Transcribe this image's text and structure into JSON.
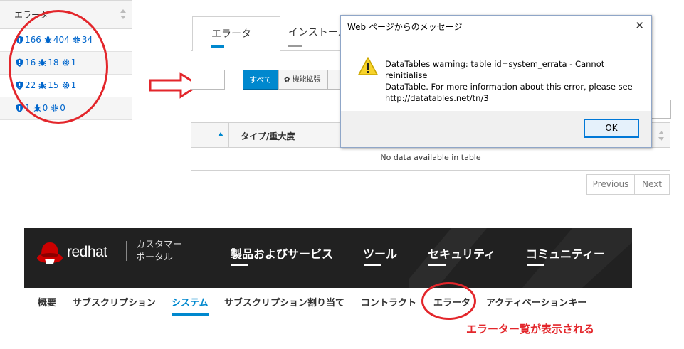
{
  "errata_table": {
    "header": "エラータ",
    "rows": [
      {
        "security": "166",
        "bugfix": "404",
        "enhancement": "34"
      },
      {
        "security": "16",
        "bugfix": "18",
        "enhancement": "1"
      },
      {
        "security": "22",
        "bugfix": "15",
        "enhancement": "1"
      },
      {
        "security": "1",
        "bugfix": "0",
        "enhancement": "0"
      }
    ]
  },
  "tabs": {
    "errata": "エラータ",
    "install": "インストール"
  },
  "filters": {
    "all": "すべて",
    "enhancement": "機能拡張"
  },
  "grid": {
    "col_type": "タイプ/重大度",
    "empty": "No data available in table",
    "previous": "Previous",
    "next": "Next"
  },
  "dialog": {
    "title": "Web ページからのメッセージ",
    "message_line1": "DataTables warning: table id=system_errata - Cannot reinitialise",
    "message_line2": "DataTable. For more information about this error, please see",
    "message_line3": "http://datatables.net/tn/3",
    "ok": "OK",
    "close": "✕"
  },
  "portal": {
    "brand": "redhat",
    "portal_line1": "カスタマー",
    "portal_line2": "ポータル",
    "nav": [
      "製品およびサービス",
      "ツール",
      "セキュリティ",
      "コミュニティー"
    ],
    "subnav": [
      "概要",
      "サブスクリプション",
      "システム",
      "サブスクリプション割り当て",
      "コントラクト",
      "エラータ",
      "アクティベーションキー"
    ],
    "active_subnav": "システム"
  },
  "annotation": {
    "caption": "エラーター覧が表示される",
    "color": "#e3262b"
  },
  "colors": {
    "accent": "#0088ce",
    "link": "#0066cc",
    "header_bg": "#212121"
  }
}
